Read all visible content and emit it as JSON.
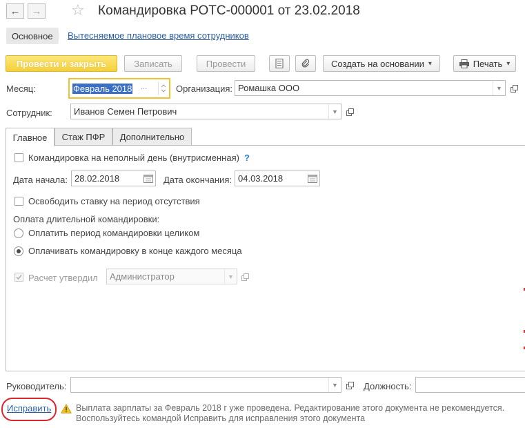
{
  "header": {
    "back_glyph": "←",
    "forward_glyph": "→",
    "star_glyph": "☆",
    "title": "Командировка РОТС-000001 от 23.02.2018"
  },
  "nav": {
    "main_label": "Основное",
    "link_label": "Вытесняемое плановое время сотрудников"
  },
  "toolbar": {
    "post_close_label": "Провести и закрыть",
    "save_label": "Записать",
    "post_label": "Провести",
    "create_based_label": "Создать на основании",
    "print_label": "Печать",
    "dropdown_glyph": "▾"
  },
  "fields": {
    "month_label": "Месяц:",
    "month_value": "Февраль 2018",
    "month_picker_glyph": "...",
    "org_label": "Организация:",
    "org_value": "Ромашка ООО",
    "employee_label": "Сотрудник:",
    "employee_value": "Иванов Семен Петрович"
  },
  "tabs": [
    {
      "label": "Главное"
    },
    {
      "label": "Стаж ПФР"
    },
    {
      "label": "Дополнительно"
    }
  ],
  "main": {
    "partial_day_label": "Командировка на неполный день (внутрисменная)",
    "help_glyph": "?",
    "start_label": "Дата начала:",
    "start_value": "28.02.2018",
    "end_label": "Дата окончания:",
    "end_value": "04.03.2018",
    "free_rate_label": "Освободить ставку на период отсутствия",
    "long_trip_payment_label": "Оплата длительной командировки:",
    "radio_whole_label": "Оплатить период командировки целиком",
    "radio_monthly_label": "Оплачивать командировку в конце каждого месяца",
    "calc_approved_label": "Расчет утвердил",
    "calc_approved_value": "Администратор",
    "radio_selected": "monthly"
  },
  "footer": {
    "manager_label": "Руководитель:",
    "manager_value": "",
    "position_label": "Должность:",
    "position_value": "",
    "fix_link": "Исправить",
    "warning_line1": "Выплата зарплаты за Февраль 2018 г уже проведена. Редактирование этого документа не рекомендуется.",
    "warning_line2": "Воспользуйтесь командой Исправить для исправления этого документа"
  },
  "colors": {
    "primary_button": "#f4cf3a",
    "link": "#2a5ea8",
    "focus_border": "#f0c230",
    "selection": "#3a6fc4",
    "warning_icon": "#f2c21b",
    "annotation_red": "#d9262b"
  }
}
